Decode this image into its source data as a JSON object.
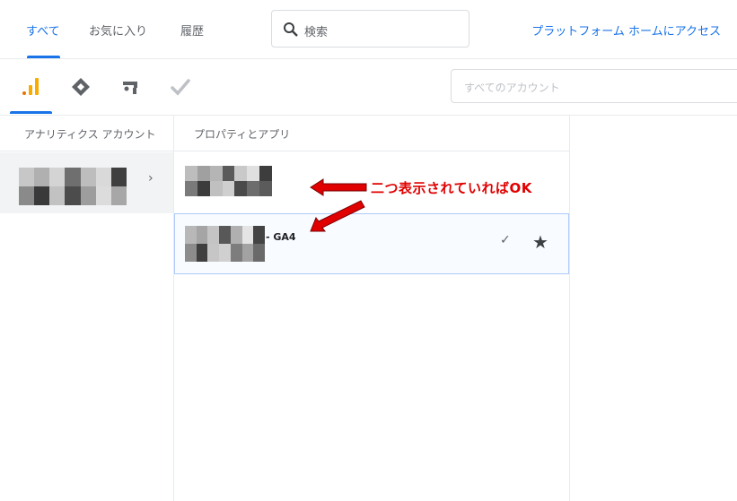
{
  "tabs": [
    {
      "label": "すべて",
      "active": true
    },
    {
      "label": "お気に入り",
      "active": false
    },
    {
      "label": "履歴",
      "active": false
    }
  ],
  "search": {
    "placeholder": "検索"
  },
  "platform_link": "プラットフォーム ホームにアクセス",
  "product_icons": [
    "analytics-icon",
    "tag-manager-icon",
    "optimize-icon",
    "surveys-check-icon"
  ],
  "account_search": {
    "placeholder": "すべてのアカウント"
  },
  "columns": {
    "accounts_header": "アナリティクス アカウント",
    "properties_header": "プロパティとアプリ"
  },
  "properties": [
    {
      "name_suffix": "",
      "selected": false
    },
    {
      "name_suffix": "- GA4",
      "selected": true,
      "check": "✓",
      "favorite": "★"
    }
  ],
  "annotation": {
    "text": "二つ表示されていればOK",
    "color": "#e00000"
  },
  "colors": {
    "accent": "#1a73e8",
    "analytics_orange": "#f9ab00"
  }
}
